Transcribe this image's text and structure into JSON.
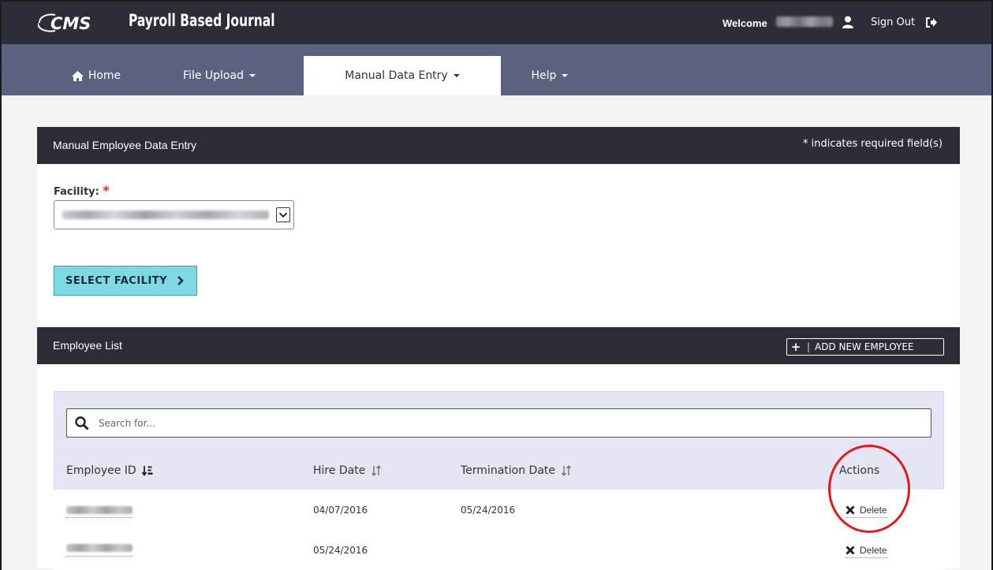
{
  "header": {
    "logo_text": "CMS",
    "app_title": "Payroll Based Journal",
    "welcome_label": "Welcome",
    "sign_out_label": "Sign Out"
  },
  "nav": {
    "items": [
      {
        "label": "Home",
        "icon": "home-icon"
      },
      {
        "label": "File Upload",
        "icon": "caret-down-icon"
      },
      {
        "label": "Manual Data Entry",
        "icon": "caret-down-icon",
        "active": true
      },
      {
        "label": "Help",
        "icon": "caret-down-icon"
      }
    ]
  },
  "manual_entry_panel": {
    "title": "Manual Employee Data Entry",
    "required_note": "* indicates required field(s)",
    "facility_label": "Facility:",
    "required_marker": "*",
    "select_facility_button": "SELECT FACILITY"
  },
  "employee_list": {
    "title": "Employee List",
    "add_button_label": "ADD NEW EMPLOYEE",
    "search_placeholder": "Search for...",
    "columns": {
      "employee_id": "Employee ID",
      "hire_date": "Hire Date",
      "termination_date": "Termination Date",
      "actions": "Actions"
    },
    "rows": [
      {
        "hire_date": "04/07/2016",
        "termination_date": "05/24/2016",
        "action": "Delete"
      },
      {
        "hire_date": "05/24/2016",
        "termination_date": "",
        "action": "Delete"
      }
    ]
  },
  "colors": {
    "header_bg": "#2c2d36",
    "nav_bg": "#5a6280",
    "button_accent": "#7dd9e6",
    "list_bg": "#e5e6f3",
    "required_red": "#c0392b",
    "annotation_red": "#e2181b"
  }
}
